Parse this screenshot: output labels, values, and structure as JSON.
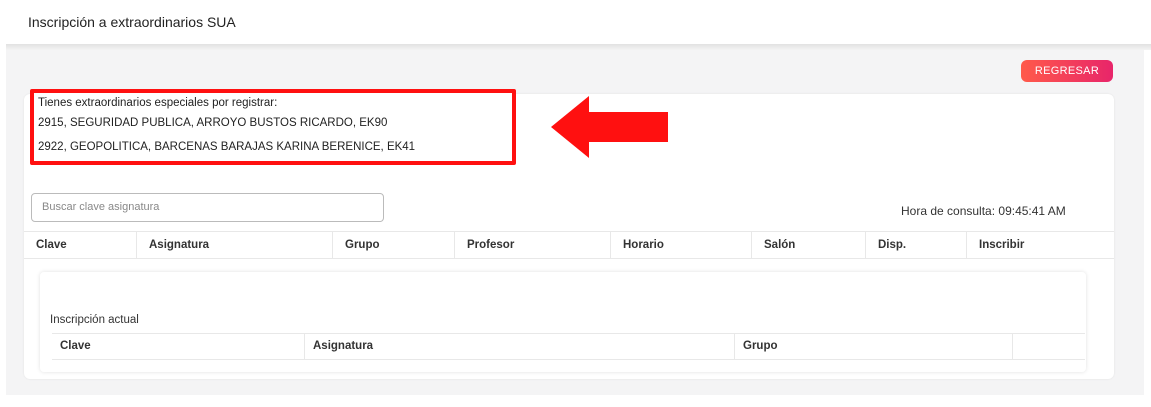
{
  "page": {
    "title": "Inscripción a extraordinarios SUA"
  },
  "actions": {
    "back_label": "REGRESAR"
  },
  "notice": {
    "heading": "Tienes extraordinarios especiales por registrar:",
    "lines": [
      "2915, SEGURIDAD PUBLICA, ARROYO BUSTOS RICARDO, EK90",
      "2922, GEOPOLITICA, BARCENAS BARAJAS KARINA BERENICE, EK41"
    ]
  },
  "search": {
    "placeholder": "Buscar clave asignatura"
  },
  "query_time": "Hora de consulta: 09:45:41 AM",
  "table": {
    "columns": [
      "Clave",
      "Asignatura",
      "Grupo",
      "Profesor",
      "Horario",
      "Salón",
      "Disp.",
      "Inscribir"
    ]
  },
  "current": {
    "title": "Inscripción actual",
    "columns": [
      "Clave",
      "Asignatura",
      "Grupo"
    ]
  },
  "colors": {
    "highlight": "#ff1010",
    "button_gradient_start": "#ff5a4a",
    "button_gradient_end": "#e8256a"
  },
  "icons": {
    "annotation": "red-arrow-left"
  }
}
